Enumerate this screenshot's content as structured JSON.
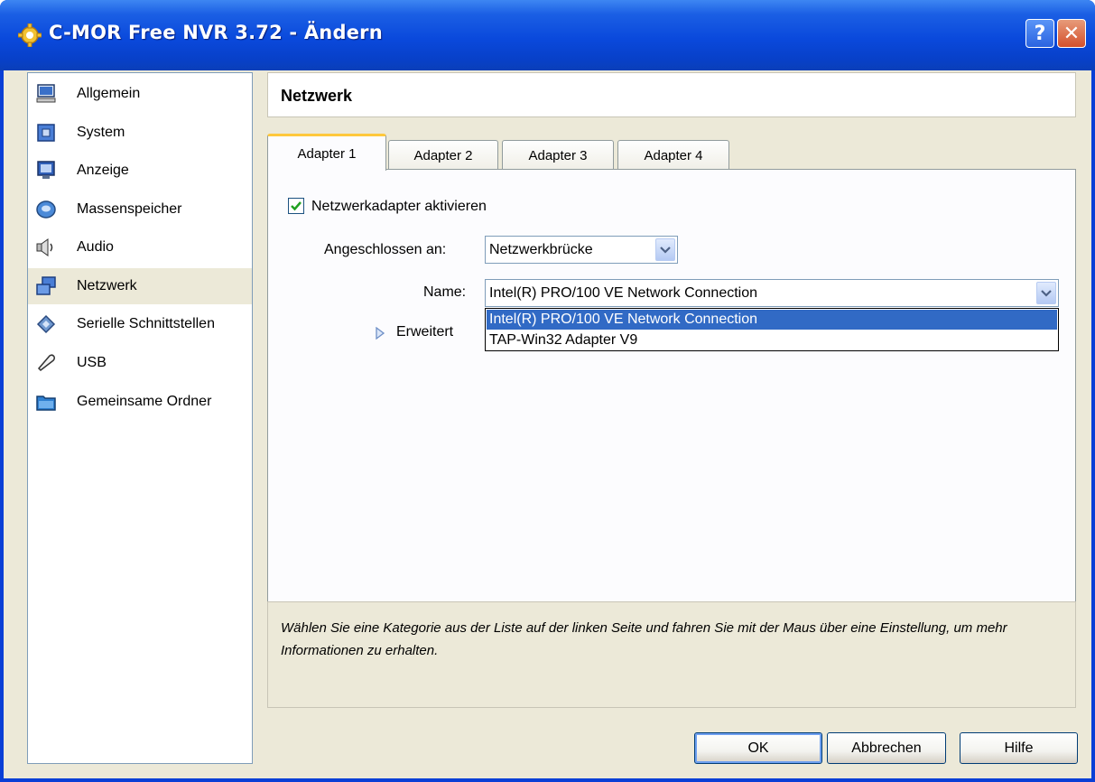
{
  "window": {
    "title": "C-MOR Free NVR 3.72 - Ändern",
    "help_glyph": "?",
    "close_glyph": "✕"
  },
  "sidebar": {
    "items": [
      {
        "label": "Allgemein",
        "icon": "computer-icon"
      },
      {
        "label": "System",
        "icon": "chip-icon"
      },
      {
        "label": "Anzeige",
        "icon": "monitor-icon"
      },
      {
        "label": "Massenspeicher",
        "icon": "disk-icon"
      },
      {
        "label": "Audio",
        "icon": "speaker-icon"
      },
      {
        "label": "Netzwerk",
        "icon": "network-icon",
        "selected": true
      },
      {
        "label": "Serielle Schnittstellen",
        "icon": "serial-port-icon"
      },
      {
        "label": "USB",
        "icon": "usb-icon"
      },
      {
        "label": "Gemeinsame Ordner",
        "icon": "folder-icon"
      }
    ]
  },
  "page": {
    "title": "Netzwerk"
  },
  "tabs": [
    {
      "label": "Adapter 1",
      "active": true
    },
    {
      "label": "Adapter 2"
    },
    {
      "label": "Adapter 3"
    },
    {
      "label": "Adapter 4"
    }
  ],
  "adapter": {
    "enable_label": "Netzwerkadapter aktivieren",
    "enabled": true,
    "attached_label": "Angeschlossen an:",
    "attached_value": "Netzwerkbrücke",
    "name_label": "Name:",
    "name_value": "Intel(R) PRO/100 VE Network Connection",
    "name_options": [
      "Intel(R) PRO/100 VE Network Connection",
      "TAP-Win32 Adapter V9"
    ],
    "advanced_label": "Erweitert"
  },
  "info": {
    "text": "Wählen Sie eine Kategorie aus der Liste auf der linken Seite und fahren Sie mit der Maus über eine Einstellung, um mehr Informationen zu erhalten."
  },
  "buttons": {
    "ok": "OK",
    "cancel": "Abbrechen",
    "help": "Hilfe"
  },
  "colors": {
    "titlebar": "#0a49dc",
    "selection": "#316ac5",
    "dialog_bg": "#ece9d8"
  }
}
